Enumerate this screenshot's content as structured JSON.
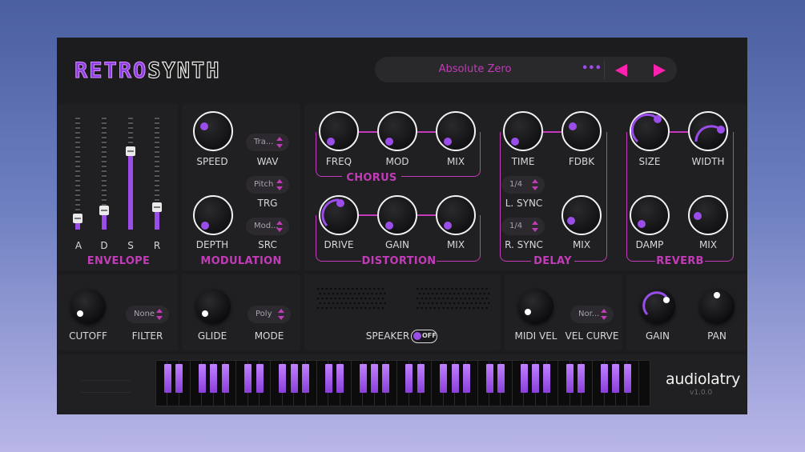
{
  "header": {
    "logo_retro": "RETRO",
    "logo_synth": "SYNTH",
    "preset_name": "Absolute Zero",
    "preset_more": "•••"
  },
  "envelope": {
    "title": "ENVELOPE",
    "sliders": [
      {
        "label": "A",
        "level": 0.1
      },
      {
        "label": "D",
        "level": 0.17
      },
      {
        "label": "S",
        "level": 0.7
      },
      {
        "label": "R",
        "level": 0.2
      }
    ]
  },
  "modulation": {
    "title": "MODULATION",
    "speed": "SPEED",
    "wav": "WAV",
    "wav_value": "Tra...",
    "trg_value": "Pitch",
    "trg": "TRG",
    "depth": "DEPTH",
    "src": "SRC",
    "src_value": "Mod..."
  },
  "chorus": {
    "title": "CHORUS",
    "freq": "FREQ",
    "mod": "MOD",
    "mix": "MIX"
  },
  "distortion": {
    "title": "DISTORTION",
    "drive": "DRIVE",
    "gain": "GAIN",
    "mix": "MIX"
  },
  "delay": {
    "title": "DELAY",
    "time": "TIME",
    "fdbk": "FDBK",
    "lsync_value": "1/4",
    "lsync": "L. SYNC",
    "rsync_value": "1/4",
    "rsync": "R. SYNC",
    "mix": "MIX"
  },
  "reverb": {
    "title": "REVERB",
    "size": "SIZE",
    "width": "WIDTH",
    "damp": "DAMP",
    "mix": "MIX"
  },
  "bottom": {
    "cutoff": "CUTOFF",
    "filter": "FILTER",
    "filter_value": "None",
    "glide": "GLIDE",
    "mode": "MODE",
    "mode_value": "Poly",
    "speaker": "SPEAKER",
    "speaker_toggle": "OFF",
    "midi_vel": "MIDI VEL",
    "vel_curve": "VEL CURVE",
    "vel_curve_value": "Nor...",
    "gain": "GAIN",
    "pan": "PAN"
  },
  "brand": {
    "name": "audiolatry",
    "version": "v1.0.0"
  },
  "colors": {
    "accent": "#c23bb8",
    "knob_dot": "#9a4de8",
    "background": "#1c1c1e"
  }
}
